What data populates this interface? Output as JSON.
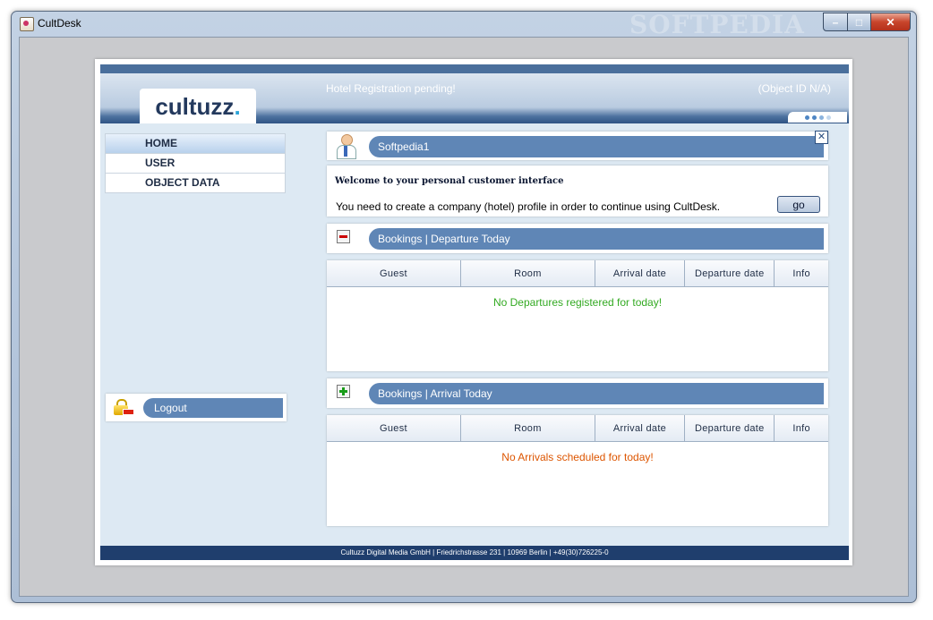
{
  "window": {
    "title": "CultDesk",
    "watermark": "SOFTPEDIA",
    "minimize_label": "–",
    "maximize_label": "□",
    "close_label": "✕"
  },
  "header": {
    "logo_text": "cultuzz",
    "logo_dot": ".",
    "status": "Hotel Registration pending!",
    "object_id": "(Object ID  N/A)"
  },
  "nav": {
    "items": [
      {
        "label": "HOME"
      },
      {
        "label": "USER"
      },
      {
        "label": "OBJECT DATA"
      }
    ]
  },
  "logout": {
    "label": "Logout"
  },
  "user_box": {
    "username": "Softpedia1",
    "close_label": "✕"
  },
  "welcome": {
    "title": "Welcome to your personal customer interface",
    "text": "You need to create a company (hotel) profile in order to continue using CultDesk.",
    "go_label": "go"
  },
  "departures": {
    "title": "Bookings | Departure Today",
    "columns": [
      "Guest",
      "Room",
      "Arrival date",
      "Departure date",
      "Info"
    ],
    "empty_message": "No Departures registered for today!"
  },
  "arrivals": {
    "title": "Bookings | Arrival Today",
    "columns": [
      "Guest",
      "Room",
      "Arrival date",
      "Departure date",
      "Info"
    ],
    "empty_message": "No Arrivals scheduled for today!"
  },
  "footer": {
    "text": "Cultuzz Digital Media GmbH | Friedrichstrasse 231 | 10969 Berlin | +49(30)726225-0"
  },
  "colors": {
    "departures_msg": "#33aa22",
    "arrivals_msg": "#dd5500",
    "nav_bar": "#5f86b6",
    "footer_bg": "#1f3e6d"
  },
  "icons": [
    "app-icon",
    "user-icon",
    "collapse-icon",
    "expand-icon",
    "lock-icon",
    "close-icon"
  ]
}
